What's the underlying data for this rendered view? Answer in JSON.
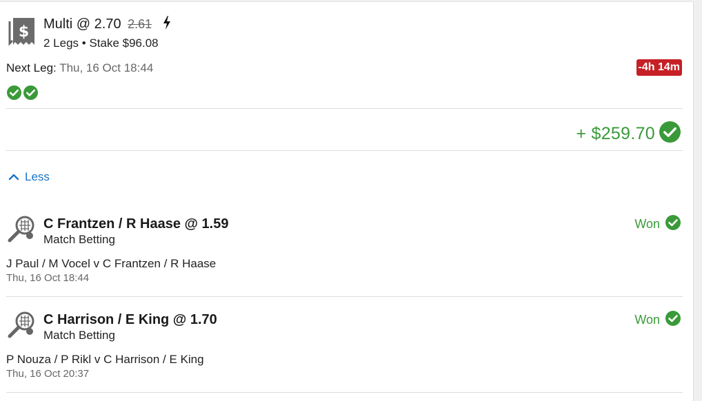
{
  "header": {
    "title": "Multi @ 2.70",
    "original_odds": "2.61",
    "subtitle": "2 Legs • Stake $96.08",
    "next_leg_label": "Next Leg:",
    "next_leg_value": "Thu, 16 Oct 18:44",
    "timer": "-4h 14m",
    "leg_status_count": 2
  },
  "payout": {
    "amount": "+ $259.70"
  },
  "toggle": {
    "label": "Less"
  },
  "legs": [
    {
      "selection": "C Frantzen / R Haase @ 1.59",
      "market": "Match Betting",
      "event": "J Paul / M Vocel v C Frantzen / R Haase",
      "date": "Thu, 16 Oct 18:44",
      "result": "Won"
    },
    {
      "selection": "C Harrison / E King @ 1.70",
      "market": "Match Betting",
      "event": "P Nouza / P Rikl v C Harrison / E King",
      "date": "Thu, 16 Oct 20:37",
      "result": "Won"
    }
  ],
  "colors": {
    "success": "#3a9a3a",
    "danger": "#c62026",
    "link": "#1a73c4"
  },
  "icons": {
    "bet_type": "receipt-dollar-icon",
    "boost": "lightning-bolt-icon",
    "check": "check-circle-icon",
    "collapse": "chevron-up-icon",
    "sport": "tennis-racket-icon"
  }
}
